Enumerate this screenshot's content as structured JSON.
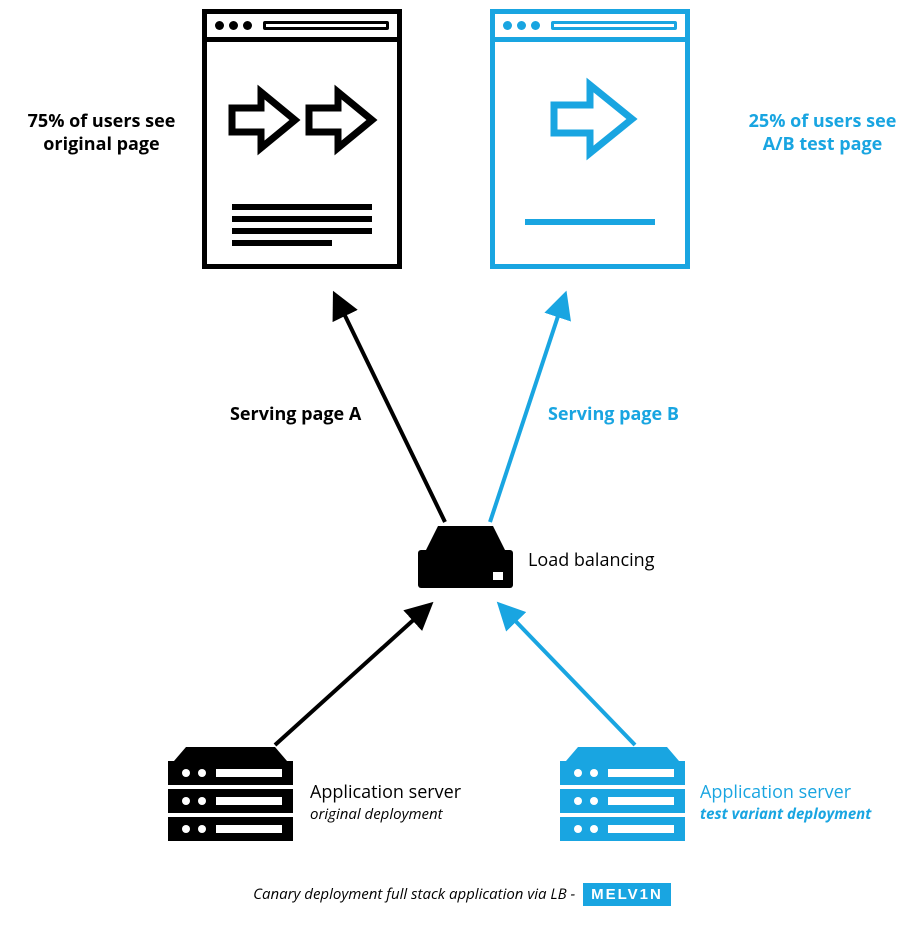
{
  "left_caption": {
    "line1": "75% of users see",
    "line2": "original page"
  },
  "right_caption": {
    "line1": "25% of users see",
    "line2": "A/B test page"
  },
  "serving_a": "Serving page A",
  "serving_b": "Serving page B",
  "load_balancing": "Load balancing",
  "app_server_left": {
    "title": "Application server",
    "subtitle": "original deployment"
  },
  "app_server_right": {
    "title": "Application server",
    "subtitle": "test variant deployment"
  },
  "footer_text": "Canary deployment full stack application via LB  -",
  "footer_badge": "MELV1N",
  "colors": {
    "black": "#000000",
    "blue": "#19a5e1"
  }
}
